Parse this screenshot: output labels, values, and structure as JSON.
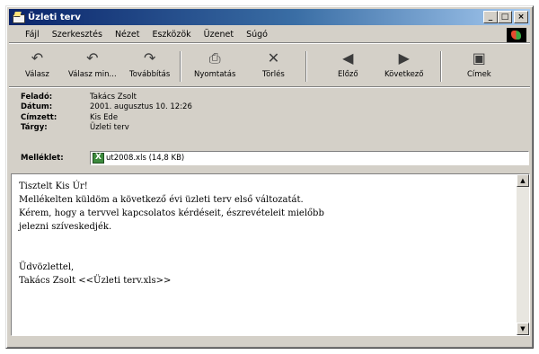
{
  "window": {
    "title": "Üzleti terv"
  },
  "titlebar_buttons": {
    "minimize": "_",
    "maximize": "□",
    "close": "×"
  },
  "menu": [
    "Fájl",
    "Szerkesztés",
    "Nézet",
    "Eszközök",
    "Üzenet",
    "Súgó"
  ],
  "toolbar": [
    {
      "label": "Válasz",
      "icon": "reply-icon"
    },
    {
      "label": "Válasz min...",
      "icon": "reply-all-icon"
    },
    {
      "label": "Továbbítás",
      "icon": "forward-icon"
    },
    {
      "label": "Nyomtatás",
      "icon": "printer-icon"
    },
    {
      "label": "Törlés",
      "icon": "delete-icon"
    },
    {
      "label": "Előző",
      "icon": "previous-icon"
    },
    {
      "label": "Következő",
      "icon": "next-icon"
    },
    {
      "label": "Címek",
      "icon": "address-book-icon"
    }
  ],
  "headers": {
    "from_label": "Feladó:",
    "from": "Takács Zsolt",
    "date_label": "Dátum:",
    "date": "2001. augusztus 10. 12:26",
    "to_label": "Címzett:",
    "to": "Kis Ede",
    "subject_label": "Tárgy:",
    "subject": "Üzleti terv",
    "attachment_label": "Melléklet:",
    "attachment": "ut2008.xls (14,8 KB)"
  },
  "body": {
    "lines": [
      "Tisztelt Kis Úr!",
      "Mellékelten küldöm a következő évi üzleti terv első változatát.",
      "Kérem, hogy a tervvel kapcsolatos kérdéseit, észrevételeit mielőbb",
      "jelezni szíveskedjék.",
      "",
      "",
      "Üdvözlettel,",
      "Takács Zsolt <<Üzleti terv.xls>>"
    ]
  }
}
